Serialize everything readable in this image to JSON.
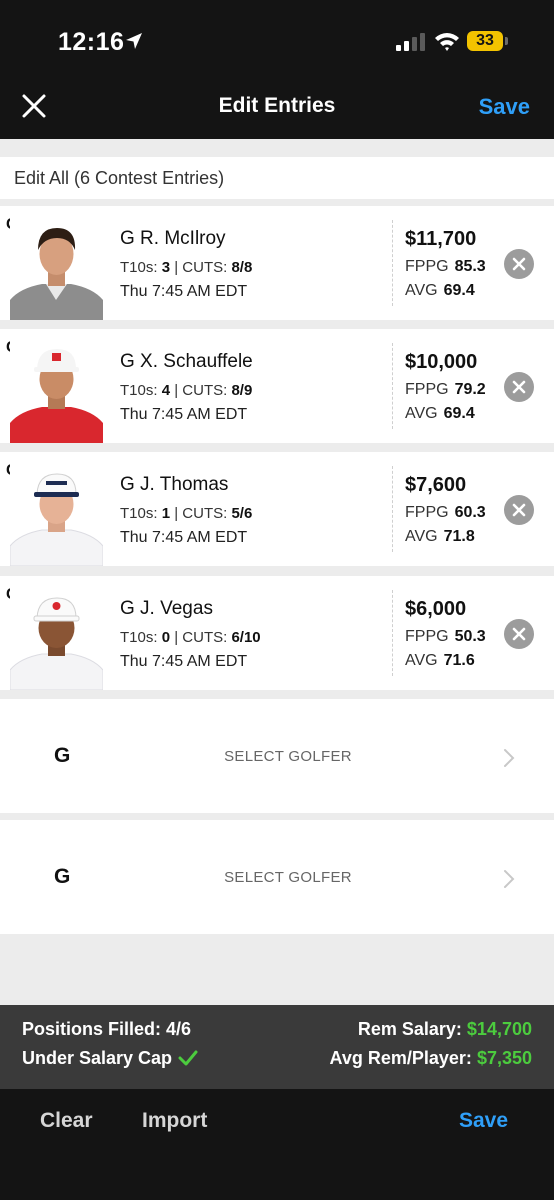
{
  "status_bar": {
    "time": "12:16",
    "battery": "33",
    "icons": [
      "location-arrow-icon",
      "cellular-signal-icon",
      "wifi-icon",
      "battery-icon"
    ]
  },
  "nav": {
    "title": "Edit Entries",
    "save_label": "Save",
    "close_icon": "close-icon",
    "accent_color": "#2f9ff8"
  },
  "edit_all": {
    "label": "Edit All (6 Contest Entries)"
  },
  "players": [
    {
      "pos": "G",
      "name": "G  R. McIlroy",
      "t10s_label": "T10s:",
      "t10s": "3",
      "sep": "|",
      "cuts_label": "CUTS:",
      "cuts": "8/8",
      "time": "Thu 7:45 AM EDT",
      "salary": "$11,700",
      "fppg_label": "FPPG",
      "fppg": "85.3",
      "avg_label": "AVG",
      "avg": "69.4",
      "shirt_color": "#8d8d8d",
      "hat": "none"
    },
    {
      "pos": "G",
      "name": "G  X. Schauffele",
      "t10s_label": "T10s:",
      "t10s": "4",
      "sep": "|",
      "cuts_label": "CUTS:",
      "cuts": "8/9",
      "time": "Thu 7:45 AM EDT",
      "salary": "$10,000",
      "fppg_label": "FPPG",
      "fppg": "79.2",
      "avg_label": "AVG",
      "avg": "69.4",
      "shirt_color": "#d9272e",
      "hat": "white"
    },
    {
      "pos": "G",
      "name": "G  J. Thomas",
      "t10s_label": "T10s:",
      "t10s": "1",
      "sep": "|",
      "cuts_label": "CUTS:",
      "cuts": "5/6",
      "time": "Thu 7:45 AM EDT",
      "salary": "$7,600",
      "fppg_label": "FPPG",
      "fppg": "60.3",
      "avg_label": "AVG",
      "avg": "71.8",
      "shirt_color": "#f4f4f6",
      "hat": "white"
    },
    {
      "pos": "G",
      "name": "G  J. Vegas",
      "t10s_label": "T10s:",
      "t10s": "0",
      "sep": "|",
      "cuts_label": "CUTS:",
      "cuts": "6/10",
      "time": "Thu 7:45 AM EDT",
      "salary": "$6,000",
      "fppg_label": "FPPG",
      "fppg": "50.3",
      "avg_label": "AVG",
      "avg": "71.6",
      "shirt_color": "#f4f4f6",
      "hat": "white"
    }
  ],
  "empty_slots": [
    {
      "pos": "G",
      "label": "SELECT GOLFER"
    },
    {
      "pos": "G",
      "label": "SELECT GOLFER"
    }
  ],
  "summary": {
    "positions_label": "Positions Filled:",
    "positions_value": "4/6",
    "cap_label": "Under Salary Cap",
    "rem_salary_label": "Rem Salary:",
    "rem_salary_value": "$14,700",
    "avg_rem_label": "Avg Rem/Player:",
    "avg_rem_value": "$7,350",
    "positive_color": "#4ccc3e"
  },
  "footer": {
    "clear_label": "Clear",
    "import_label": "Import",
    "save_label": "Save"
  }
}
